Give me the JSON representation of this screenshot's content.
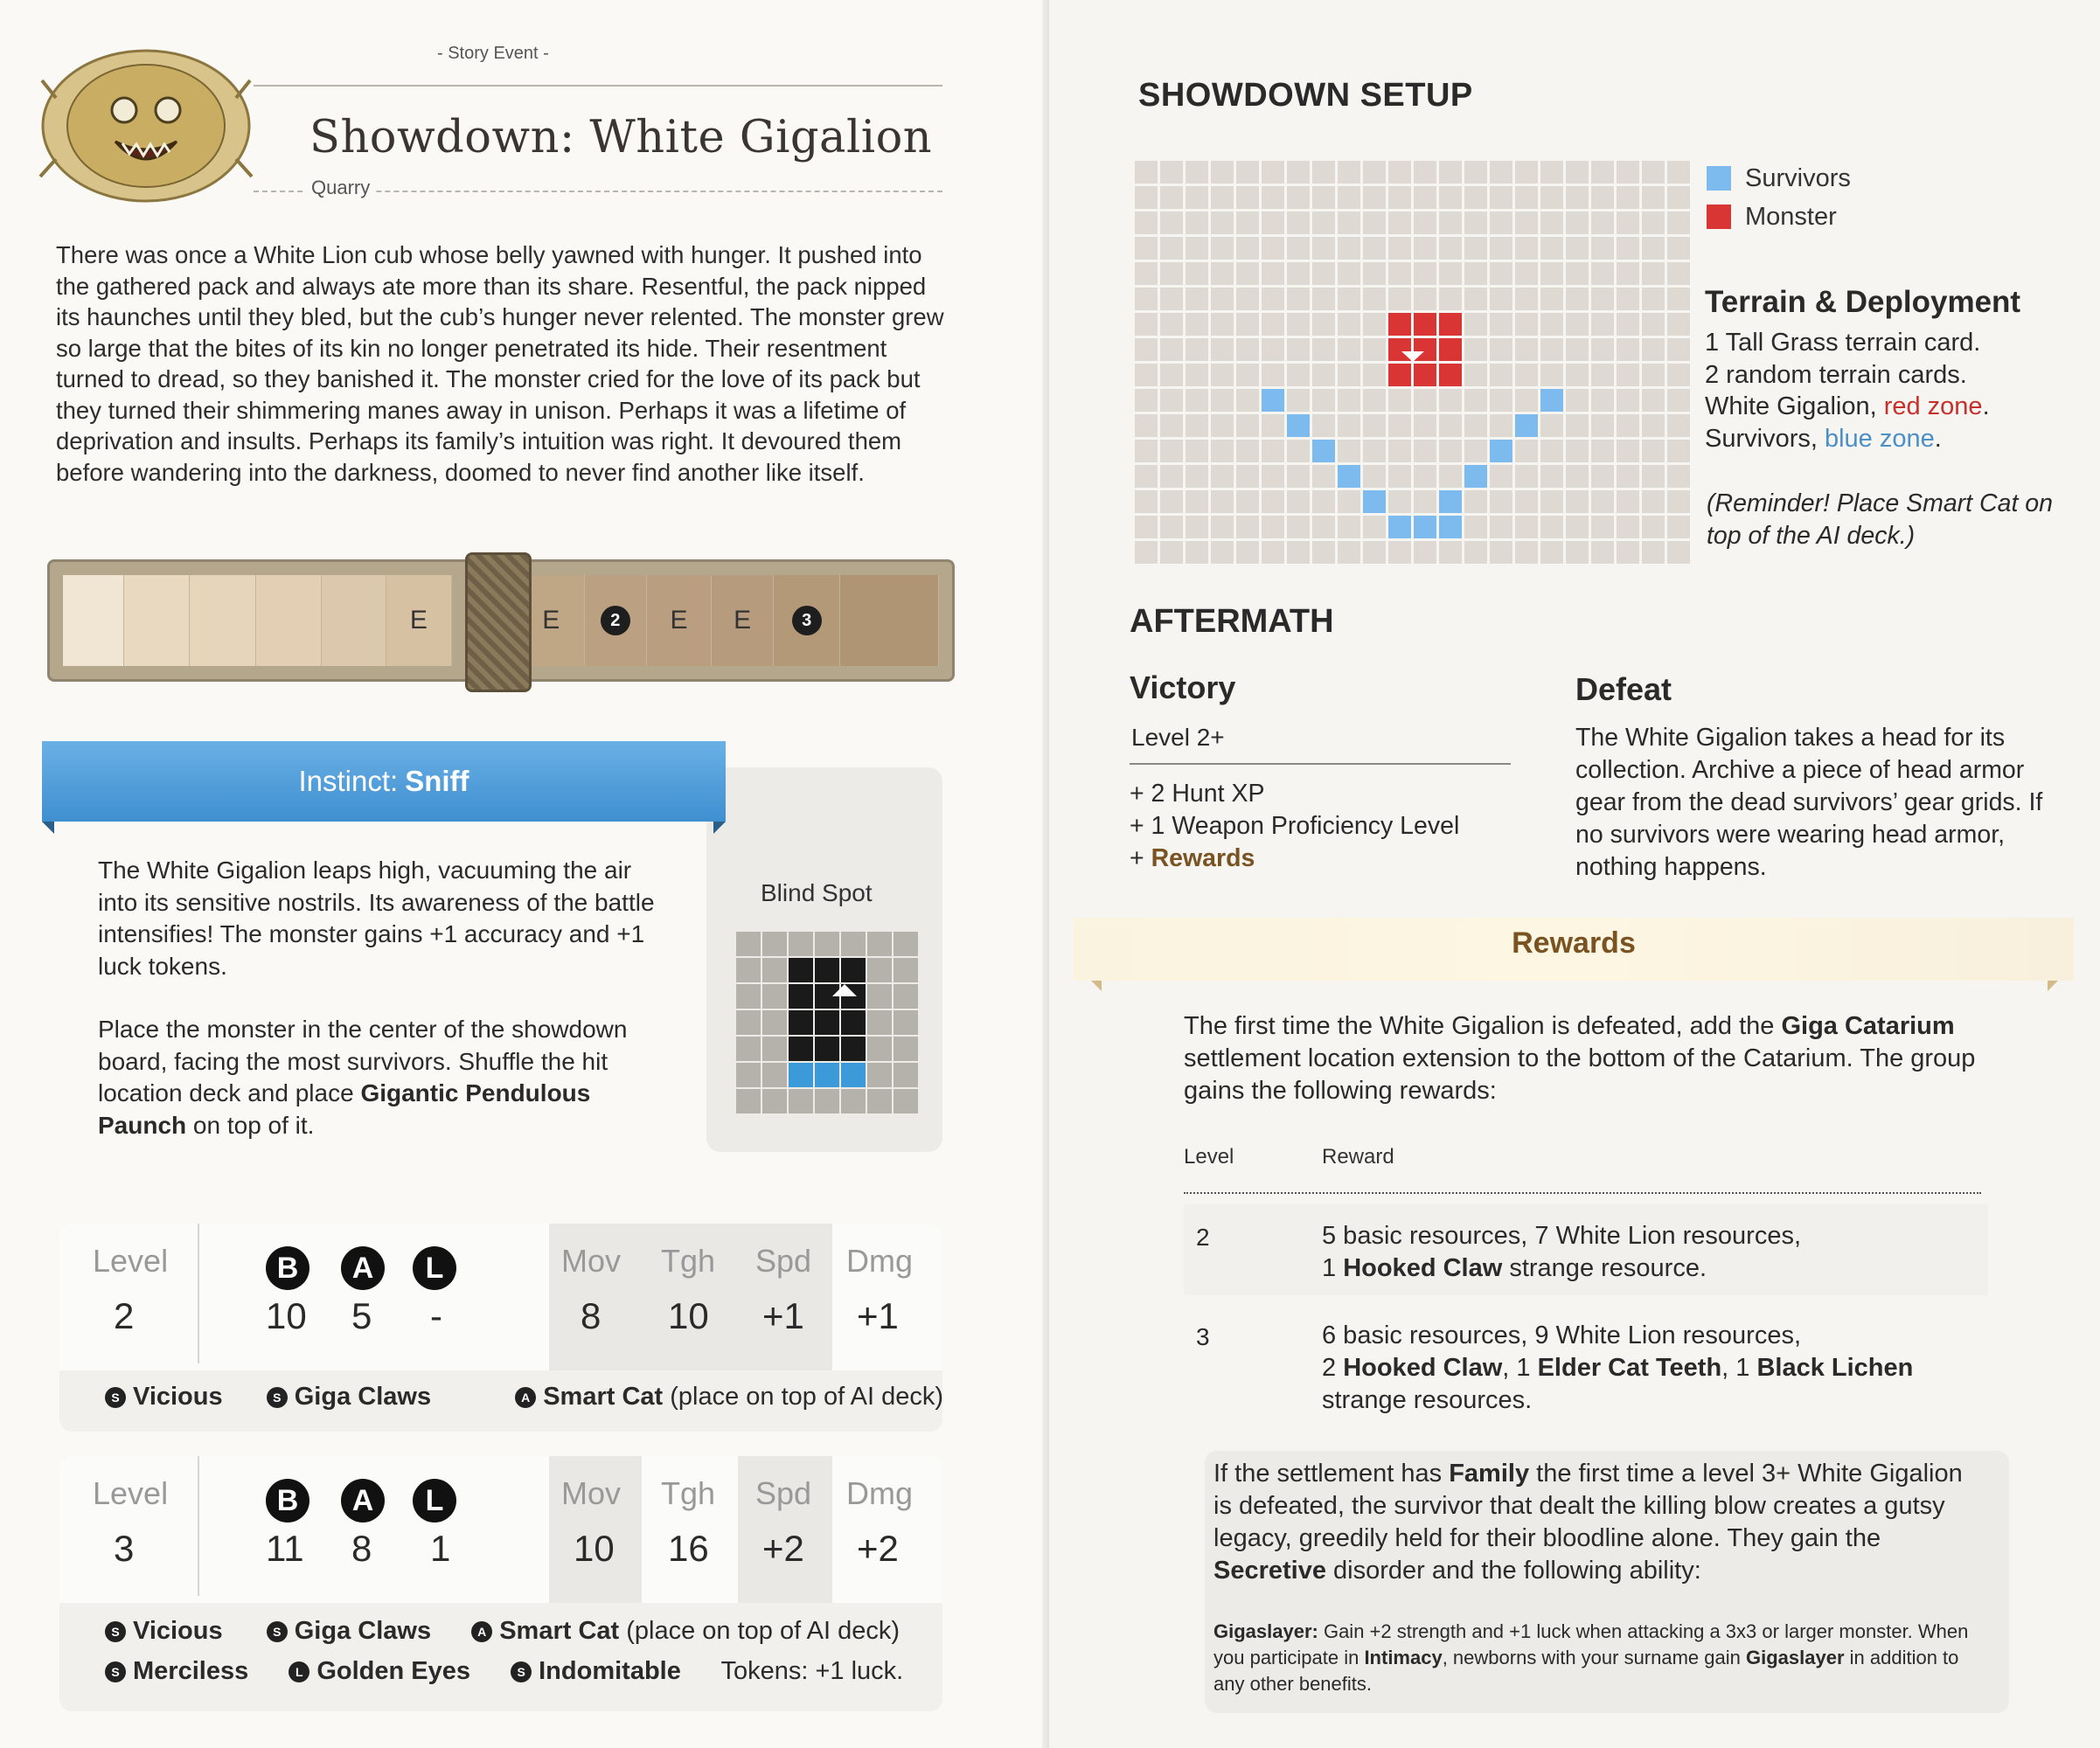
{
  "left": {
    "story_event": "- Story Event -",
    "title": "Showdown: White Gigalion",
    "quarry": "Quarry",
    "intro": "There was once a White Lion cub whose belly yawned with hunger. It pushed into the gathered pack and always ate more than its share. Resentful, the pack nipped its haunches until they bled, but the cub’s hunger never relented. The monster grew so large that the bites of its kin no longer penetrated its hide. Their resentment turned to dread, so they banished it. The monster cried for the love of its pack but they turned their shimmering manes away in unison. Perhaps it was a lifetime of deprivation and insults. Perhaps its family’s intuition was right. It devoured them before wandering into the darkness, doomed to never find another like itself.",
    "hunt_track": {
      "spaces": [
        "",
        "",
        "",
        "",
        "",
        "E",
        "E",
        "2",
        "E",
        "E",
        "3",
        ""
      ]
    },
    "instinct": {
      "label": "Instinct:",
      "name": "Sniff",
      "para1": "The White Gigalion leaps high, vacuuming the air into its sensitive nostrils. Its awareness of the battle intensifies! The monster gains +1 accuracy and +1 luck tokens.",
      "para2_a": "Place the monster in the center of the showdown board, facing the most survivors. Shuffle the hit location deck and place ",
      "para2_b": "Gigantic Pendulous Paunch",
      "para2_c": " on top of it.",
      "blind_spot": "Blind Spot"
    },
    "stat_headers": {
      "level": "Level",
      "b": "B",
      "a": "A",
      "l": "L",
      "mov": "Mov",
      "tgh": "Tgh",
      "spd": "Spd",
      "dmg": "Dmg"
    },
    "level2": {
      "level": "2",
      "b": "10",
      "a": "5",
      "l": "-",
      "mov": "8",
      "tgh": "10",
      "spd": "+1",
      "dmg": "+1",
      "t_vicious": "Vicious",
      "t_giga": "Giga Claws",
      "t_smart": "Smart Cat",
      "t_smart_note": " (place on top of AI deck)",
      "icon_s": "S",
      "icon_a": "A"
    },
    "level3": {
      "level": "3",
      "b": "11",
      "a": "8",
      "l": "1",
      "mov": "10",
      "tgh": "16",
      "spd": "+2",
      "dmg": "+2",
      "t_vicious": "Vicious",
      "t_giga": "Giga Claws",
      "t_smart": "Smart Cat",
      "t_smart_note": " (place on top of AI deck)",
      "t_merciless": "Merciless",
      "t_golden": "Golden Eyes",
      "t_indomitable": "Indomitable",
      "tokens": "Tokens: +1 luck.",
      "icon_s": "S",
      "icon_a": "A",
      "icon_l": "L"
    }
  },
  "right": {
    "setup_title": "SHOWDOWN SETUP",
    "legend_survivors": "Survivors",
    "legend_monster": "Monster",
    "terrain_title": "Terrain & Deployment",
    "terrain_l1": "1 Tall Grass terrain card.",
    "terrain_l2": "2 random terrain cards.",
    "terrain_l3a": "White Gigalion, ",
    "terrain_l3b": "red zone",
    "terrain_l4a": "Survivors, ",
    "terrain_l4b": "blue zone",
    "reminder": "(Reminder! Place Smart Cat on top of the AI deck.)",
    "aftermath_title": "AFTERMATH",
    "victory_title": "Victory",
    "victory_level": "Level 2+",
    "victory_1": "+ 2 Hunt XP",
    "victory_2": "+ 1 Weapon Proficiency Level",
    "victory_3a": "+ ",
    "victory_3b": "Rewards",
    "defeat_title": "Defeat",
    "defeat_body": "The White Gigalion takes a head for its collection. Archive a piece of head armor gear from the dead survivors’ gear grids. If no survivors were wearing head armor, nothing happens.",
    "rewards_title": "Rewards",
    "rewards_intro_a": "The first time the White Gigalion is defeated, add the ",
    "rewards_intro_b": "Giga Catarium",
    "rewards_intro_c": " settlement location extension to the bottom of the Catarium. The group gains the following rewards:",
    "table_level": "Level",
    "table_reward": "Reward",
    "row2_level": "2",
    "row2_a": "5 basic resources, 7 White Lion resources,",
    "row2_b": "1 ",
    "row2_c": "Hooked Claw",
    "row2_d": " strange resource.",
    "row3_level": "3",
    "row3_a": "6 basic resources, 9 White Lion resources,",
    "row3_b": "2 ",
    "row3_c": "Hooked Claw",
    "row3_d": ", 1 ",
    "row3_e": "Elder Cat Teeth",
    "row3_f": ", 1 ",
    "row3_g": "Black Lichen",
    "row3_h": "strange resources.",
    "family_a": "If the settlement has ",
    "family_b": "Family",
    "family_c": " the first time a level 3+ White Gigalion is defeated, the survivor that dealt the killing blow creates a gutsy legacy, greedily held for their bloodline alone. They gain the ",
    "family_d": "Secretive",
    "family_e": " disorder and the following ability:",
    "gs_a": "Gigaslayer:",
    "gs_b": " Gain +2 strength and +1 luck when attacking a 3x3 or larger monster. When you participate in ",
    "gs_c": "Intimacy",
    "gs_d": ", newborns with your surname gain ",
    "gs_e": "Gigaslayer",
    "gs_f": " in addition to any other benefits."
  },
  "colors": {
    "blue_zone": "#7dbbef",
    "red_zone": "#d93535",
    "instinct_banner": "#4a9ad8",
    "rewards_accent": "#7a5322"
  }
}
